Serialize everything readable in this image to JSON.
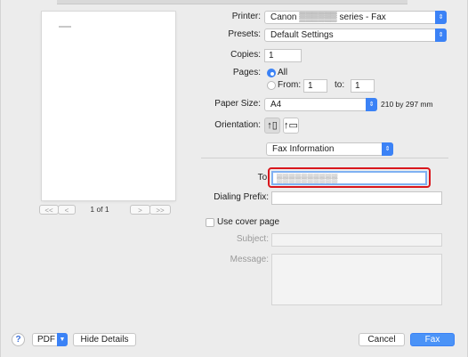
{
  "preview": {
    "page_count": "1 of 1",
    "nav_first": "<<",
    "nav_prev": "<",
    "nav_next": ">",
    "nav_last": ">>"
  },
  "printer": {
    "label": "Printer:",
    "value": "Canon ▒▒▒▒▒▒ series - Fax"
  },
  "presets": {
    "label": "Presets:",
    "value": "Default Settings"
  },
  "copies": {
    "label": "Copies:",
    "value": "1"
  },
  "pages": {
    "label": "Pages:",
    "all_label": "All",
    "from_label": "From:",
    "from_value": "1",
    "to_label": "to:",
    "to_value": "1"
  },
  "paper_size": {
    "label": "Paper Size:",
    "value": "A4",
    "dimensions": "210 by 297 mm"
  },
  "orientation": {
    "label": "Orientation:"
  },
  "section_popup": {
    "value": "Fax Information"
  },
  "fax": {
    "to_label": "To:",
    "to_value": "▒▒▒▒▒▒▒▒▒▒",
    "dialing_prefix_label": "Dialing Prefix:",
    "dialing_prefix_value": "",
    "cover_page_label": "Use cover page",
    "subject_label": "Subject:",
    "subject_value": "",
    "message_label": "Message:",
    "message_value": ""
  },
  "footer": {
    "help": "?",
    "pdf": "PDF",
    "hide_details": "Hide Details",
    "cancel": "Cancel",
    "fax": "Fax"
  },
  "colors": {
    "accent": "#3b82f6",
    "highlight": "#d9161c"
  }
}
